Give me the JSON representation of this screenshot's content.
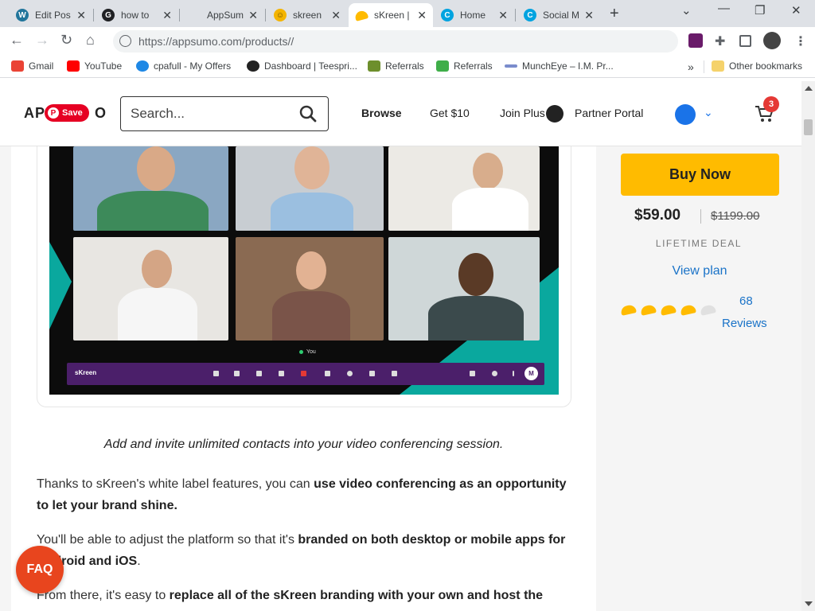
{
  "browser": {
    "tabs": [
      {
        "title": "Edit Pos",
        "icon": "wordpress-icon",
        "color": "#21759b",
        "glyph": "W"
      },
      {
        "title": "how to",
        "icon": "google-icon",
        "color": "#202124",
        "glyph": "G"
      },
      {
        "title": "AppSum",
        "icon": "blank-page-icon",
        "color": "#dee1e6",
        "glyph": ""
      },
      {
        "title": "skreen",
        "icon": "emoji-icon",
        "color": "#f4b400",
        "glyph": "☺"
      },
      {
        "title": "sKreen |",
        "icon": "appsumo-taco-icon",
        "color": "#ffbb00",
        "glyph": ""
      },
      {
        "title": "Home",
        "icon": "canva-icon",
        "color": "#00a3e0",
        "glyph": "C"
      },
      {
        "title": "Social M",
        "icon": "canva-icon",
        "color": "#00a3e0",
        "glyph": "C"
      }
    ],
    "url": "https://appsumo.com/products//",
    "bookmarks": [
      {
        "label": "Gmail",
        "icon": "gmail-icon",
        "color": "#ea4335"
      },
      {
        "label": "YouTube",
        "icon": "youtube-icon",
        "color": "#ff0000"
      },
      {
        "label": "cpafull - My Offers",
        "icon": "cpafull-icon",
        "color": "#1e88e5"
      },
      {
        "label": "Dashboard | Teespri...",
        "icon": "teespring-icon",
        "color": "#222222"
      },
      {
        "label": "Referrals",
        "icon": "leaf-icon",
        "color": "#6d8f2c"
      },
      {
        "label": "Referrals",
        "icon": "leaf-icon",
        "color": "#3fae49"
      },
      {
        "label": "MunchEye – I.M. Pr...",
        "icon": "muncheye-icon",
        "color": "#7a8ccc"
      }
    ],
    "more_label": "»",
    "other_bookmarks": "Other bookmarks"
  },
  "header": {
    "logo_left": "AP",
    "logo_right": "O",
    "pinterest_save": "Save",
    "search_placeholder": "Search...",
    "nav": {
      "browse": "Browse",
      "get10": "Get $10",
      "join_plus": "Join Plus",
      "partner_portal": "Partner Portal"
    },
    "cart_count": "3"
  },
  "content": {
    "video_brand": "sKreen",
    "you_label": "You",
    "avatar_initial": "M",
    "caption": "Add and invite unlimited contacts into your video conferencing session.",
    "p1_a": "Thanks to sKreen's white label features, you can ",
    "p1_b": "use video conferencing as an opportunity to let your brand shine.",
    "p2_a": "You'll be able to adjust the platform so that it's ",
    "p2_b": "branded on both desktop or mobile apps for Android and iOS",
    "p2_c": ".",
    "p3_a": "From there, it's easy to ",
    "p3_b": "replace all of the sKreen branding with your own and host the",
    "faq": "FAQ"
  },
  "sidebar": {
    "buy_now": "Buy Now",
    "price": "$59.00",
    "old_price": "$1199.00",
    "deal_label": "LIFETIME DEAL",
    "view_plan": "View plan",
    "rating": 4,
    "rating_max": 5,
    "reviews_count": "68",
    "reviews_label": "Reviews"
  },
  "colors": {
    "accent_yellow": "#ffbb00",
    "link_blue": "#1a73c8",
    "faq_orange": "#e8451e",
    "video_bar_purple": "#4b1f6a",
    "teal": "#0aa89e"
  }
}
